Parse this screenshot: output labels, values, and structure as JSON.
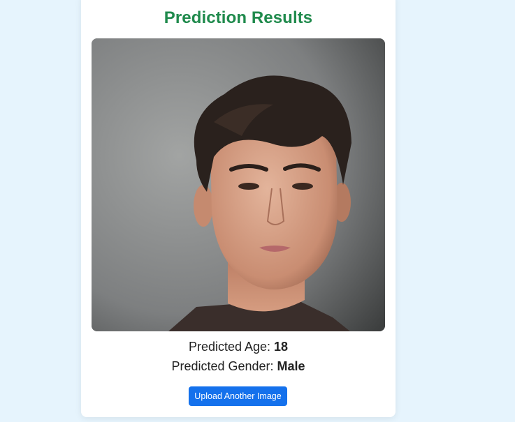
{
  "page": {
    "title": "Prediction Results",
    "age_label": "Predicted Age: ",
    "age_value": "18",
    "gender_label": "Predicted Gender: ",
    "gender_value": "Male",
    "upload_button_label": "Upload Another Image"
  },
  "colors": {
    "background": "#e6f4fd",
    "title": "#1f8a4c",
    "button": "#1471ec"
  }
}
